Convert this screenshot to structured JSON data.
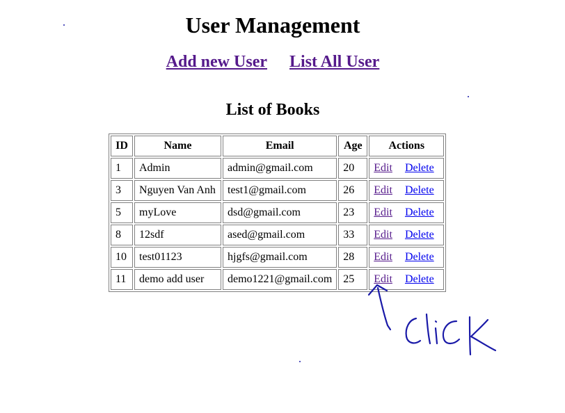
{
  "page": {
    "title": "User Management",
    "add_link": "Add new User",
    "list_link": "List All User",
    "table_title": "List of Books"
  },
  "table": {
    "headers": [
      "ID",
      "Name",
      "Email",
      "Age",
      "Actions"
    ],
    "rows": [
      {
        "id": "1",
        "name": "Admin",
        "email": "admin@gmail.com",
        "age": "20",
        "edit": "Edit",
        "delete": "Delete"
      },
      {
        "id": "3",
        "name": "Nguyen Van Anh",
        "email": "test1@gmail.com",
        "age": "26",
        "edit": "Edit",
        "delete": "Delete"
      },
      {
        "id": "5",
        "name": "myLove",
        "email": "dsd@gmail.com",
        "age": "23",
        "edit": "Edit",
        "delete": "Delete"
      },
      {
        "id": "8",
        "name": "12sdf",
        "email": "ased@gmail.com",
        "age": "33",
        "edit": "Edit",
        "delete": "Delete"
      },
      {
        "id": "10",
        "name": "test01123",
        "email": "hjgfs@gmail.com",
        "age": "28",
        "edit": "Edit",
        "delete": "Delete"
      },
      {
        "id": "11",
        "name": "demo add user",
        "email": "demo1221@gmail.com",
        "age": "25",
        "edit": "Edit",
        "delete": "Delete"
      }
    ]
  },
  "annotation": {
    "color": "#1a1aa8"
  },
  "colors": {
    "visited_link": "#551a8b",
    "link": "#0000ee",
    "border": "#808080"
  }
}
